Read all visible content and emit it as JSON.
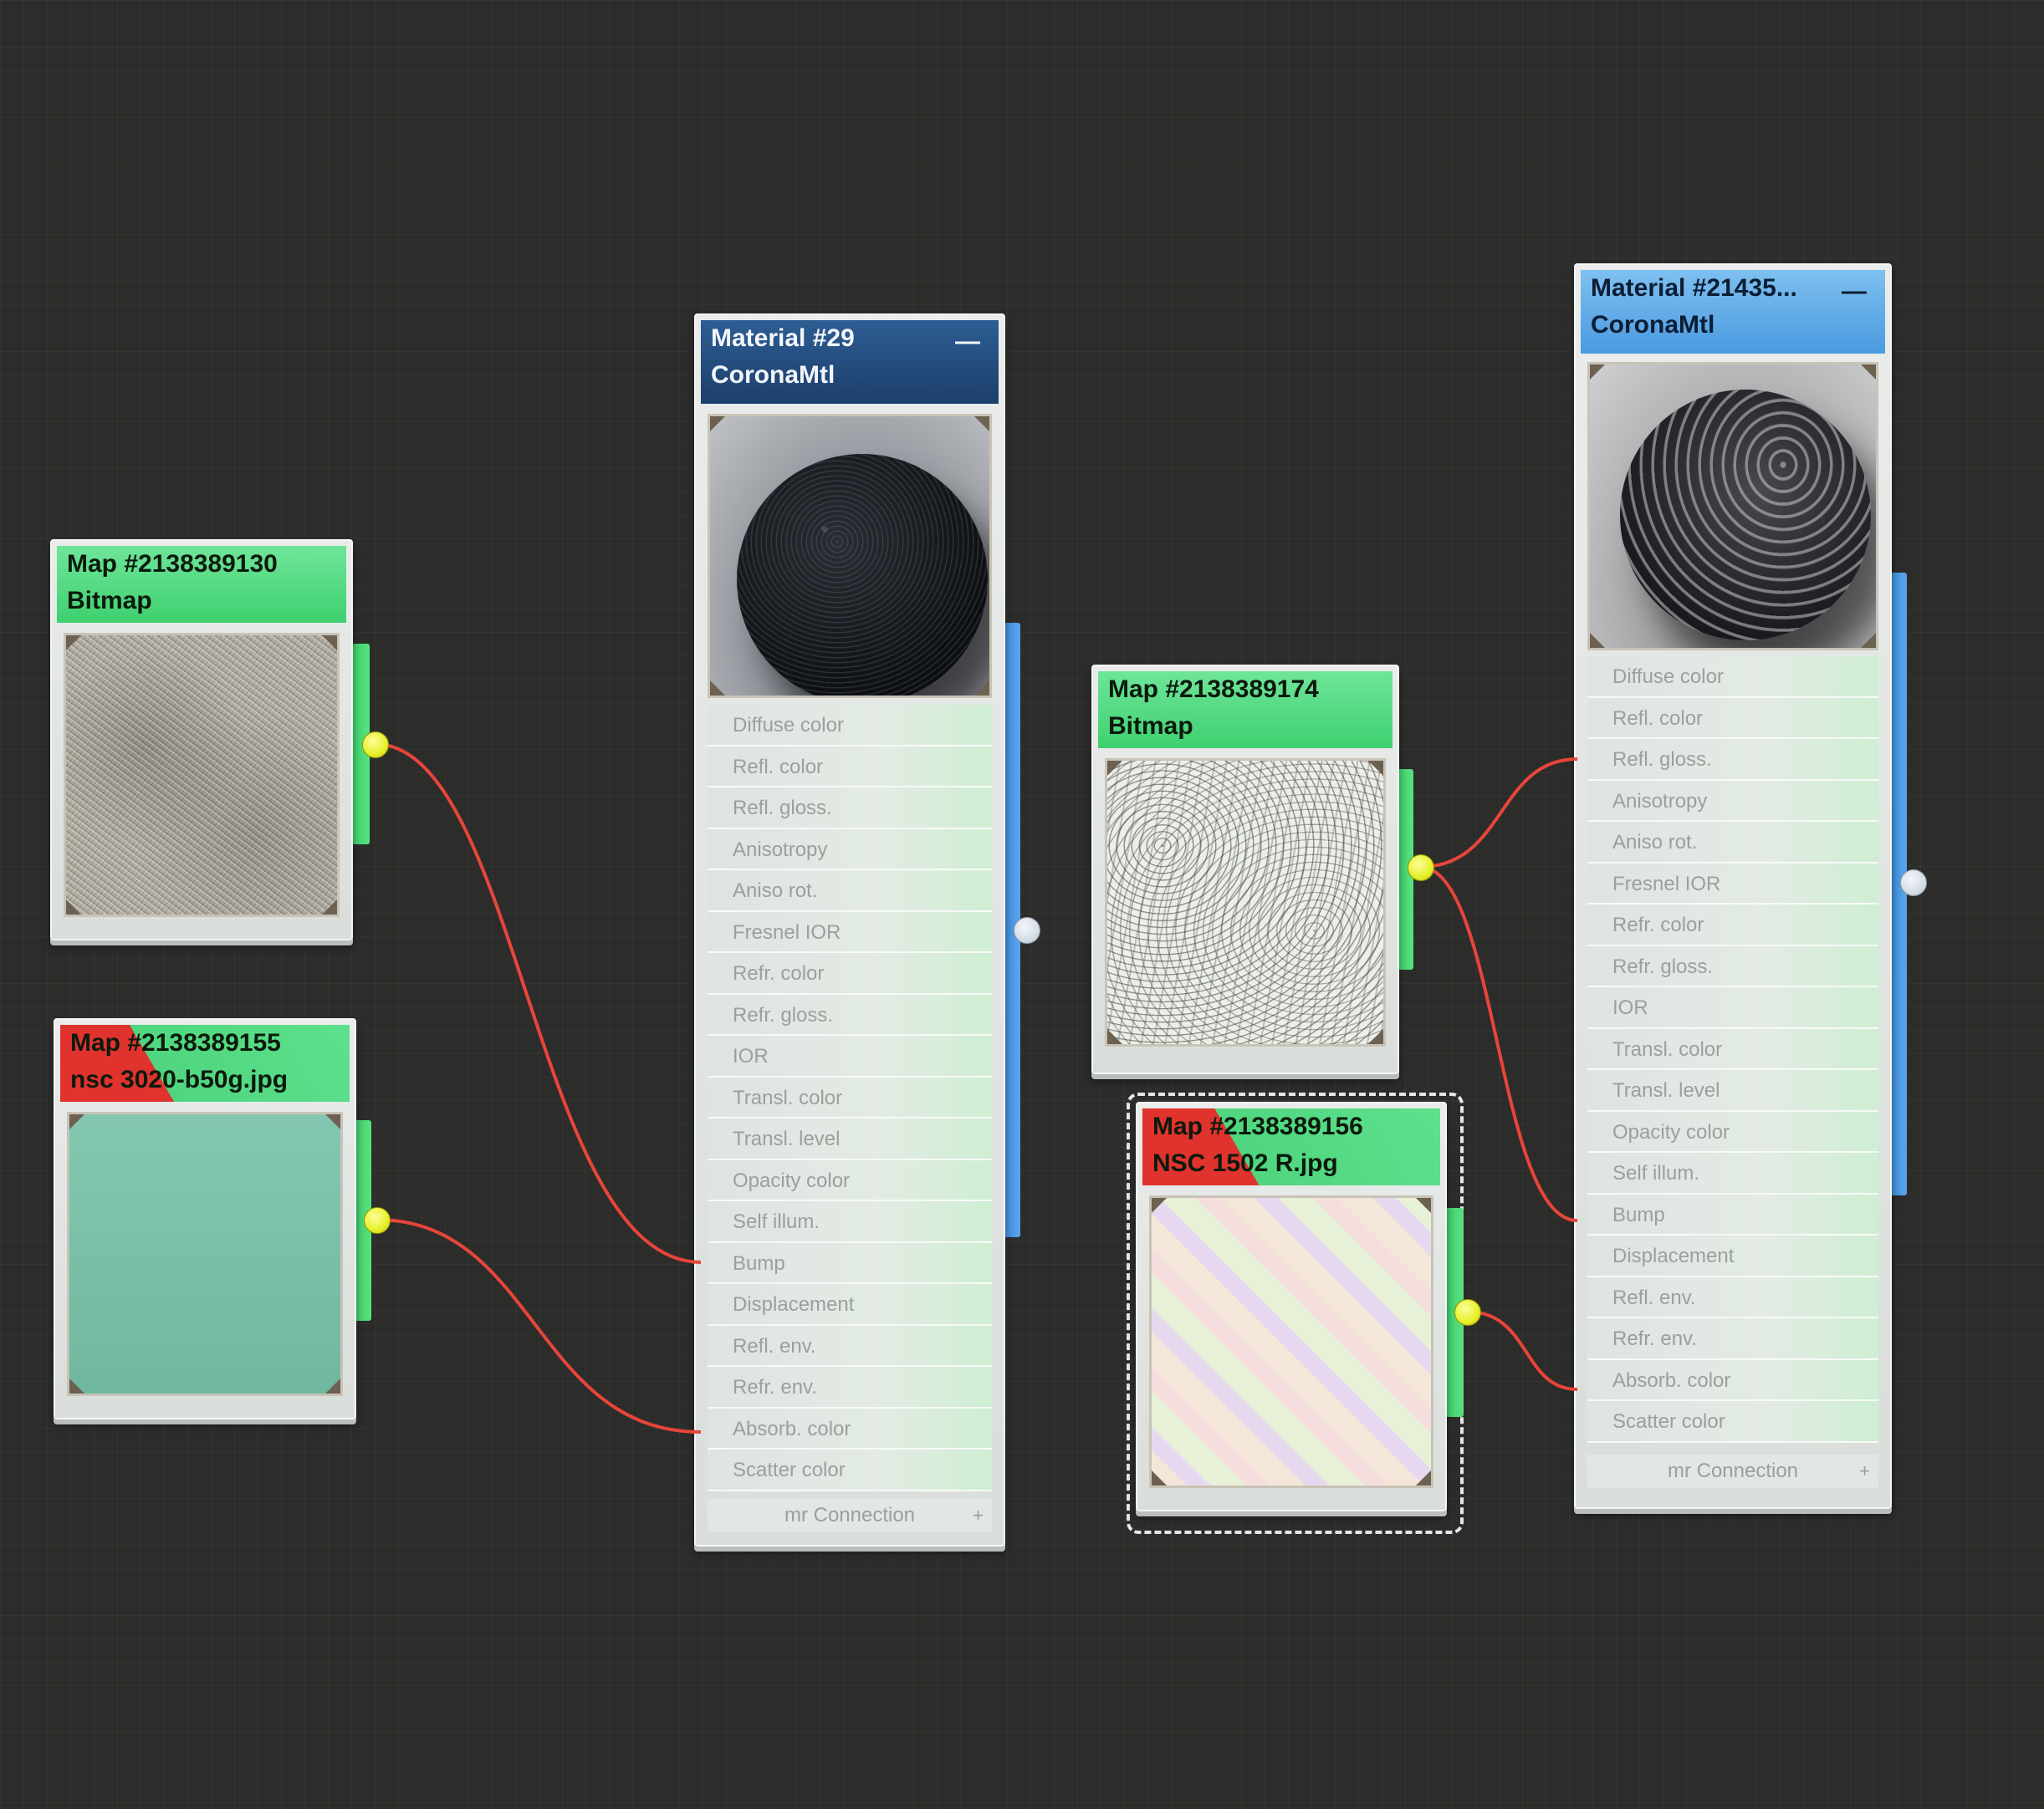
{
  "nodes": {
    "map1": {
      "title": "Map #2138389130",
      "subtitle": "Bitmap"
    },
    "map2": {
      "title": "Map #2138389155",
      "subtitle": "nsc 3020-b50g.jpg"
    },
    "mat1": {
      "title": "Material #29",
      "subtitle": "CoronaMtl",
      "minimize": "—",
      "footer": "mr Connection",
      "footer_plus": "+"
    },
    "map3": {
      "title": "Map #2138389174",
      "subtitle": "Bitmap"
    },
    "map4": {
      "title": "Map #2138389156",
      "subtitle": "NSC 1502 R.jpg"
    },
    "mat2": {
      "title": "Material #21435...",
      "subtitle": "CoronaMtl",
      "minimize": "—",
      "footer": "mr Connection",
      "footer_plus": "+"
    }
  },
  "slots_mat1": [
    "Diffuse color",
    "Refl. color",
    "Refl. gloss.",
    "Anisotropy",
    "Aniso rot.",
    "Fresnel IOR",
    "Refr. color",
    "Refr. gloss.",
    "IOR",
    "Transl. color",
    "Transl. level",
    "Opacity color",
    "Self illum.",
    "Bump",
    "Displacement",
    "Refl. env.",
    "Refr. env.",
    "Absorb. color",
    "Scatter color"
  ],
  "slots_mat2": [
    "Diffuse color",
    "Refl. color",
    "Refl. gloss.",
    "Anisotropy",
    "Aniso rot.",
    "Fresnel IOR",
    "Refr. color",
    "Refr. gloss.",
    "IOR",
    "Transl. color",
    "Transl. level",
    "Opacity color",
    "Self illum.",
    "Bump",
    "Displacement",
    "Refl. env.",
    "Refr. env.",
    "Absorb. color",
    "Scatter color"
  ],
  "connected_slots": {
    "mat1": [
      "Bump",
      "Absorb. color"
    ],
    "mat2": [
      "Refl. gloss.",
      "Bump",
      "Absorb. color"
    ]
  },
  "colors": {
    "background": "#2c2c2a",
    "wire": "#e8453a",
    "header_green": "#3ed06f",
    "header_blue": "#1c3f6b",
    "header_sky": "#4a9ae0",
    "header_missing": "#e0332e",
    "active_port": "#e7f02a"
  }
}
